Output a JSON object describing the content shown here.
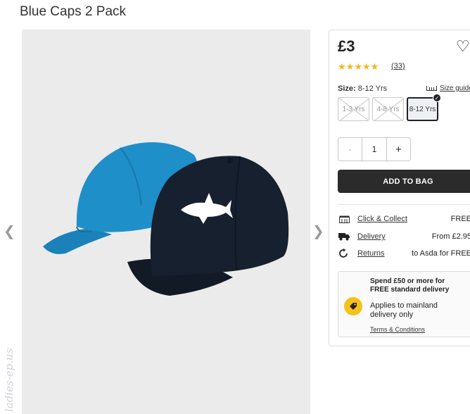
{
  "product": {
    "title": "Blue Caps 2 Pack",
    "price": "£3",
    "review_count": "(33)",
    "rating": 5,
    "rating_max": 5
  },
  "size": {
    "label": "Size:",
    "selected_value": "8-12 Yrs",
    "guide_label": "Size guide",
    "options": [
      {
        "label": "1-3 Yrs",
        "available": false,
        "selected": false
      },
      {
        "label": "4-8 Yrs",
        "available": false,
        "selected": false
      },
      {
        "label": "8-12 Yrs",
        "available": true,
        "selected": true
      }
    ]
  },
  "quantity": {
    "minus": "-",
    "value": "1",
    "plus": "+"
  },
  "add_to_bag": "ADD TO BAG",
  "delivery": [
    {
      "icon": "store-icon",
      "label": "Click & Collect",
      "value": "FREE"
    },
    {
      "icon": "truck-icon",
      "label": "Delivery",
      "value": "From £2.95"
    },
    {
      "icon": "returns-icon",
      "label": "Returns",
      "value": "to Asda for FREE"
    }
  ],
  "promo": {
    "headline": "Spend £50 or more for FREE standard delivery",
    "body": "Applies to mainland delivery only",
    "terms": "Terms & Conditions"
  },
  "watermark": "ladies-ep.us",
  "colors": {
    "star": "#f3b71c",
    "button_bg": "#2b2b2b",
    "promo_icon": "#f4c21b",
    "cap_blue": "#1f8fc9",
    "cap_navy": "#16202e"
  }
}
